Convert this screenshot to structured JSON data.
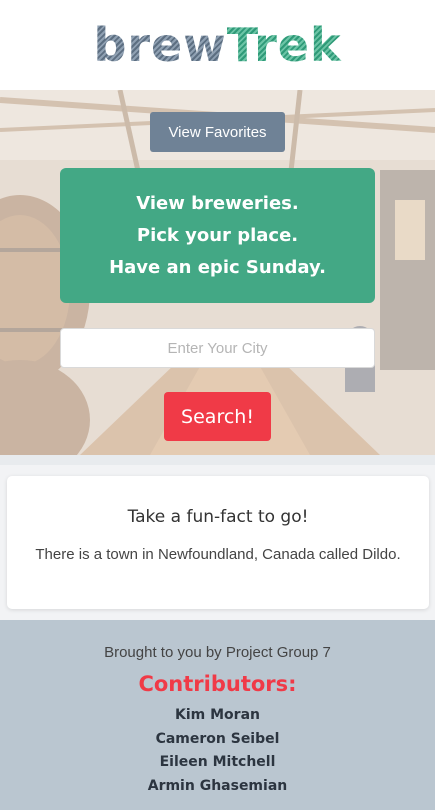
{
  "header": {
    "logo_part1": "brew",
    "logo_part2": "Trek"
  },
  "hero": {
    "favorites_button": "View Favorites",
    "tagline": [
      "View breweries.",
      "Pick your place.",
      "Have an epic Sunday."
    ],
    "city_input": {
      "value": "",
      "placeholder": "Enter Your City"
    },
    "search_button": "Search!"
  },
  "fun_fact": {
    "title": "Take a fun-fact to go!",
    "text": "There is a town in Newfoundland, Canada called Dildo."
  },
  "footer": {
    "credit": "Brought to you by Project Group 7",
    "contributors_title": "Contributors:",
    "contributors": [
      "Kim Moran",
      "Cameron Seibel",
      "Eileen Mitchell",
      "Armin Ghasemian"
    ]
  },
  "colors": {
    "accent_green": "#43a885",
    "accent_red": "#f03a47",
    "slate": "#6f8296",
    "footer_bg": "#bac6d0"
  }
}
